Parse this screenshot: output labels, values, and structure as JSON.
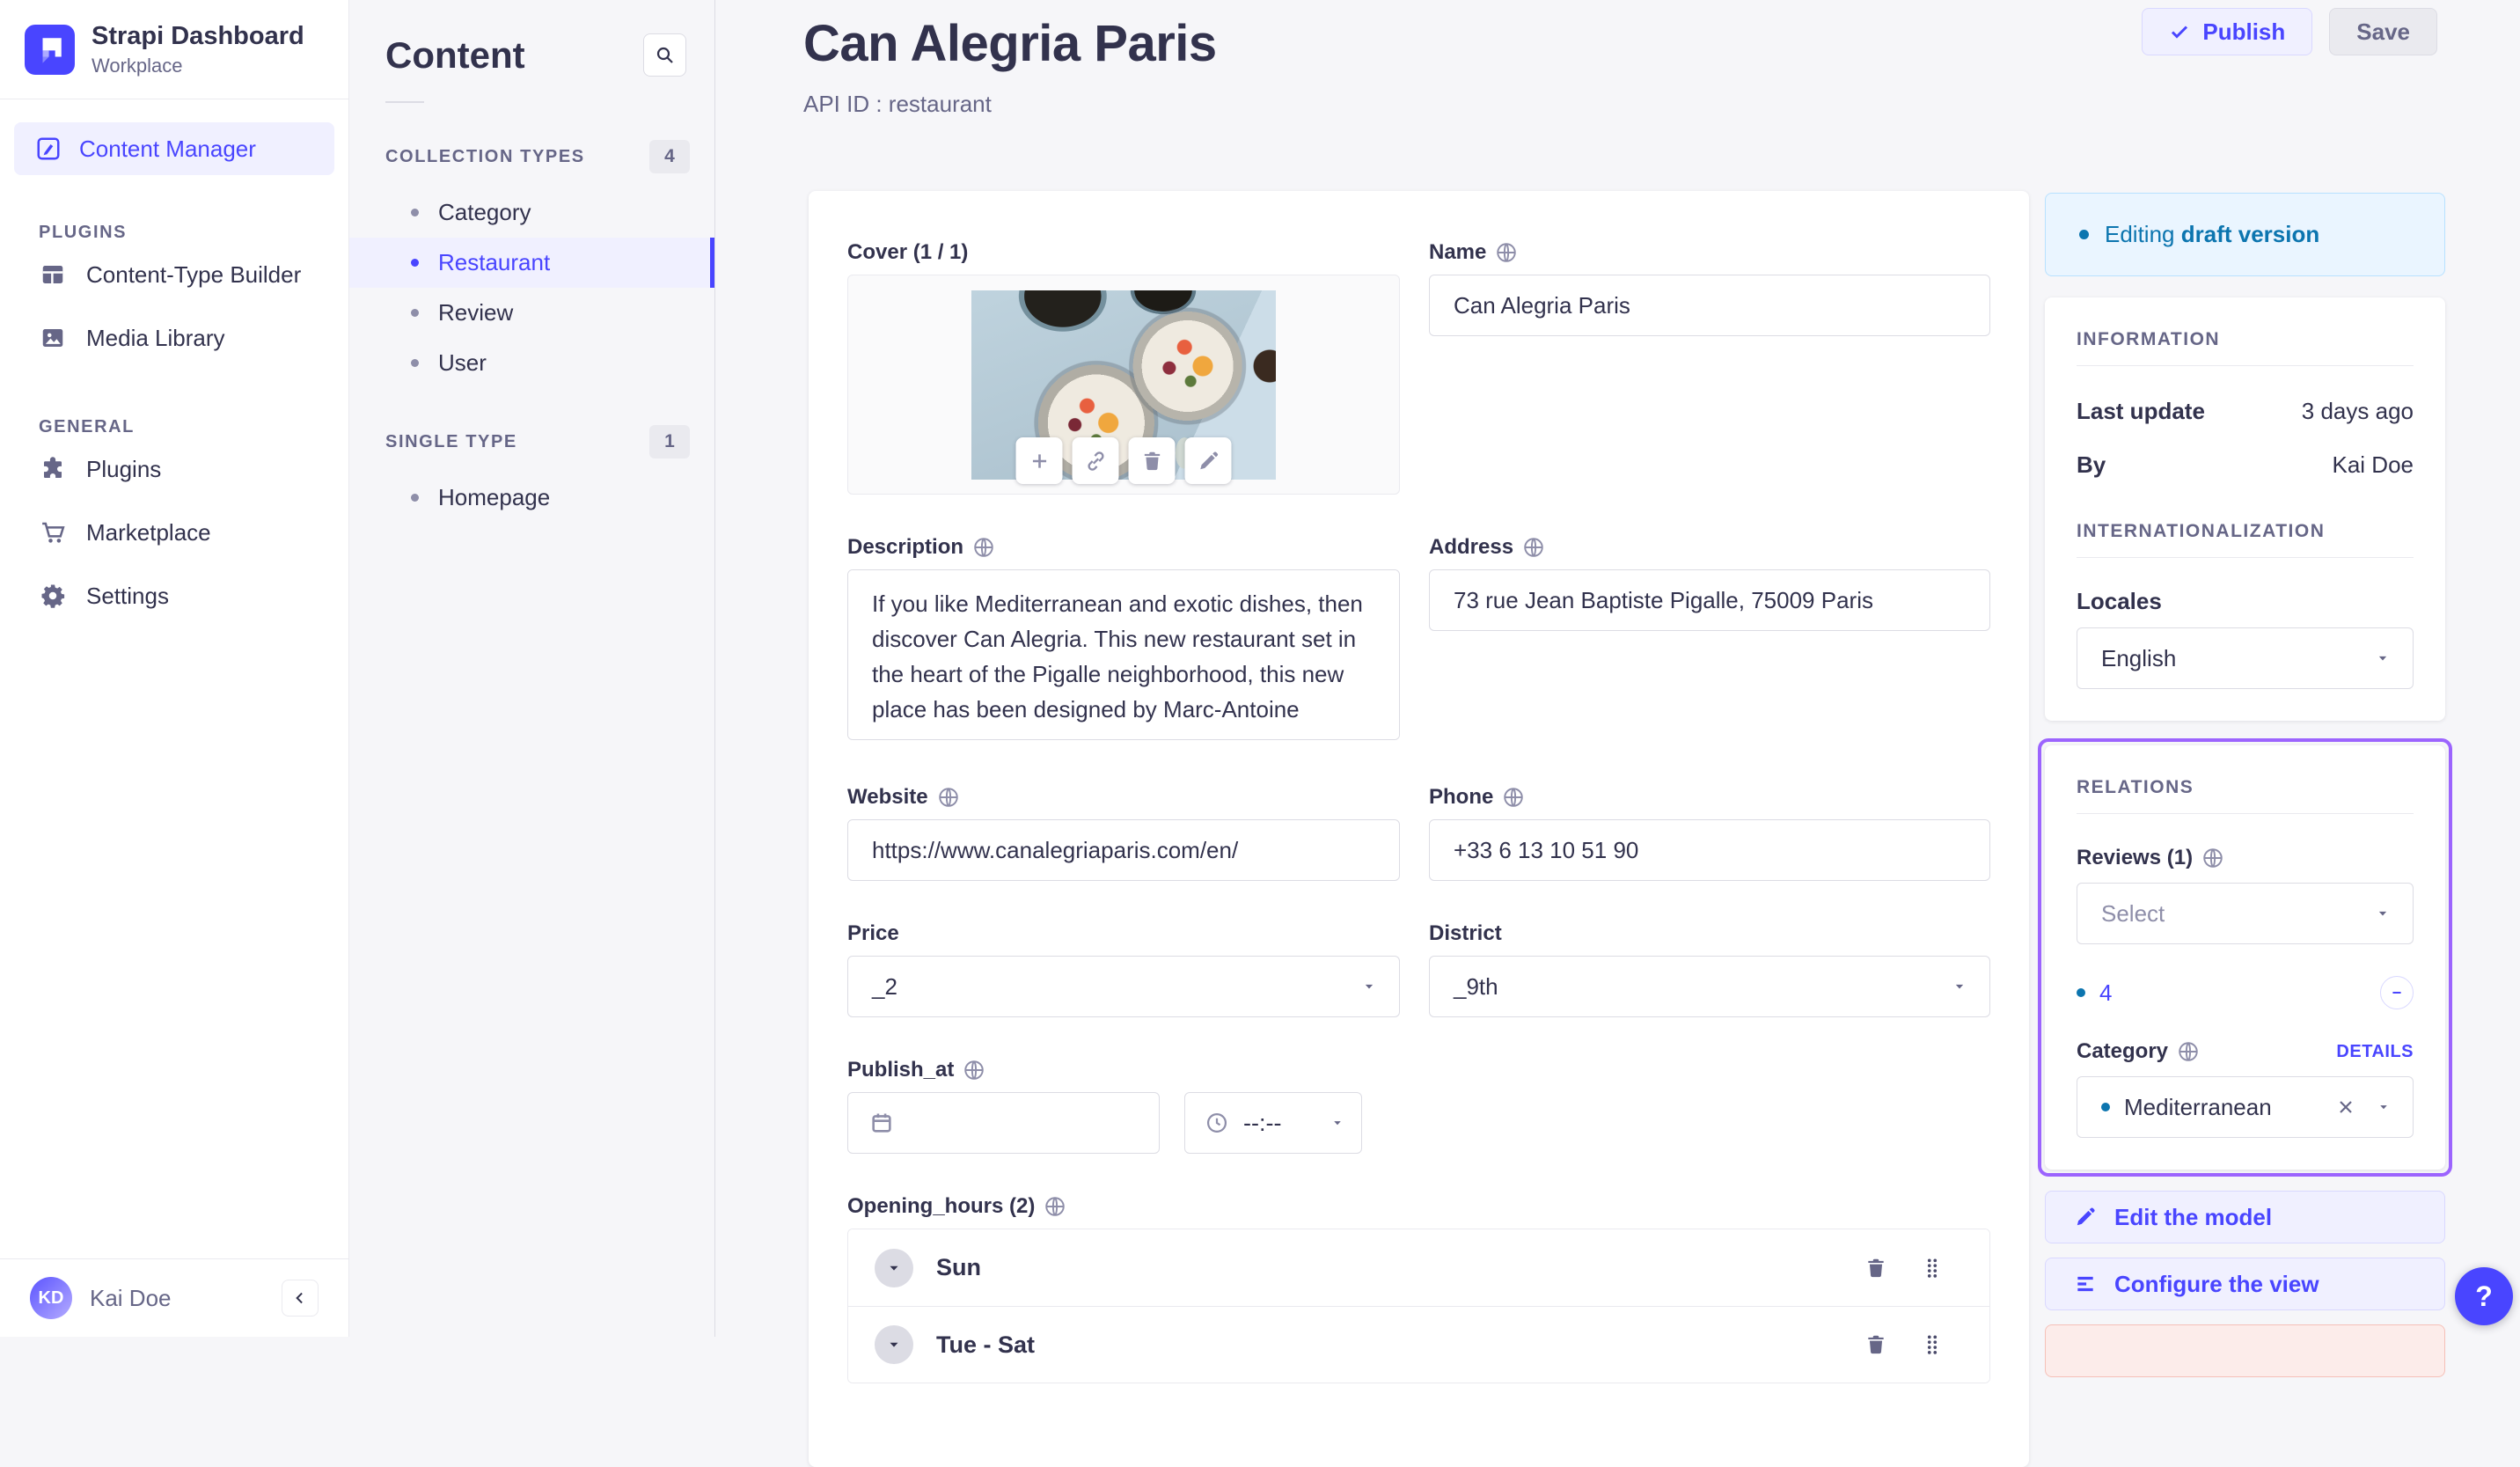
{
  "app": {
    "name": "Strapi Dashboard",
    "workspace": "Workplace"
  },
  "nav": {
    "content_manager": "Content Manager",
    "plugins_label": "PLUGINS",
    "plugins_items": [
      {
        "icon": "layout-icon",
        "label": "Content-Type Builder"
      },
      {
        "icon": "image-icon",
        "label": "Media Library"
      }
    ],
    "general_label": "GENERAL",
    "general_items": [
      {
        "icon": "puzzle-icon",
        "label": "Plugins"
      },
      {
        "icon": "cart-icon",
        "label": "Marketplace"
      },
      {
        "icon": "gear-icon",
        "label": "Settings"
      }
    ],
    "user": {
      "initials": "KD",
      "name": "Kai Doe"
    }
  },
  "subnav": {
    "title": "Content",
    "collection_types": {
      "label": "COLLECTION TYPES",
      "count": "4",
      "items": [
        {
          "label": "Category",
          "active": false
        },
        {
          "label": "Restaurant",
          "active": true
        },
        {
          "label": "Review",
          "active": false
        },
        {
          "label": "User",
          "active": false
        }
      ]
    },
    "single_type": {
      "label": "SINGLE TYPE",
      "count": "1",
      "items": [
        {
          "label": "Homepage",
          "active": false
        }
      ]
    }
  },
  "header": {
    "title": "Can Alegria Paris",
    "api_id": "API ID : restaurant",
    "publish_label": "Publish",
    "save_label": "Save"
  },
  "form": {
    "cover": {
      "label": "Cover (1 / 1)"
    },
    "name": {
      "label": "Name",
      "value": "Can Alegria Paris"
    },
    "description": {
      "label": "Description",
      "value": "If you like Mediterranean and exotic dishes, then discover Can Alegria. This new restaurant set in the heart of the Pigalle neighborhood, this new place has been designed by Marc-Antoine"
    },
    "address": {
      "label": "Address",
      "value": "73 rue Jean Baptiste Pigalle, 75009 Paris"
    },
    "website": {
      "label": "Website",
      "value": "https://www.canalegriaparis.com/en/"
    },
    "phone": {
      "label": "Phone",
      "value": "+33 6 13 10 51 90"
    },
    "price": {
      "label": "Price",
      "value": "_2"
    },
    "district": {
      "label": "District",
      "value": "_9th"
    },
    "publish_at": {
      "label": "Publish_at",
      "date_value": "",
      "time_placeholder": "--:--"
    },
    "opening_hours": {
      "label": "Opening_hours (2)",
      "rows": [
        {
          "label": "Sun"
        },
        {
          "label": "Tue - Sat"
        }
      ]
    }
  },
  "panel": {
    "draft_banner": {
      "prefix": "Editing ",
      "bold": "draft version"
    },
    "information": {
      "label": "INFORMATION",
      "last_update_label": "Last update",
      "last_update_value": "3 days ago",
      "by_label": "By",
      "by_value": "Kai Doe"
    },
    "i18n": {
      "label": "INTERNATIONALIZATION",
      "locales_label": "Locales",
      "locale_value": "English"
    },
    "relations": {
      "label": "RELATIONS",
      "reviews_label": "Reviews (1)",
      "reviews_placeholder": "Select",
      "review_item": "4",
      "category_label": "Category",
      "details_label": "DETAILS",
      "category_value": "Mediterranean"
    },
    "edit_model": "Edit the model",
    "configure_view": "Configure the view",
    "help": "?"
  },
  "icons": {
    "strapi-logo": "white stepped square mark",
    "edit-icon": "pencil in rounded square",
    "layout-icon": "panel layout grid",
    "image-icon": "picture with mountain",
    "puzzle-icon": "jigsaw piece",
    "cart-icon": "shopping cart",
    "gear-icon": "settings gear",
    "search-icon": "magnifier",
    "globe-icon": "internationalized field globe",
    "check-icon": "checkmark",
    "plus-icon": "add media",
    "link-icon": "copy link chain",
    "trash-icon": "delete trash can",
    "pencil-icon": "edit pencil",
    "calendar-icon": "date picker calendar",
    "clock-icon": "time picker clock",
    "chevron-down-icon": "dropdown caret",
    "drag-handle-icon": "drag dots",
    "minus-icon": "remove relation",
    "close-icon": "clear selection x",
    "menu-lines-icon": "configure list lines",
    "question-icon": "help question mark",
    "collapse-icon": "collapse chevron left"
  },
  "colors": {
    "primary": "#4945ff",
    "primary_light": "#f0f0ff",
    "draft_blue": "#0c75af",
    "highlight_purple": "#9c64fe",
    "background": "#f6f6f9"
  }
}
